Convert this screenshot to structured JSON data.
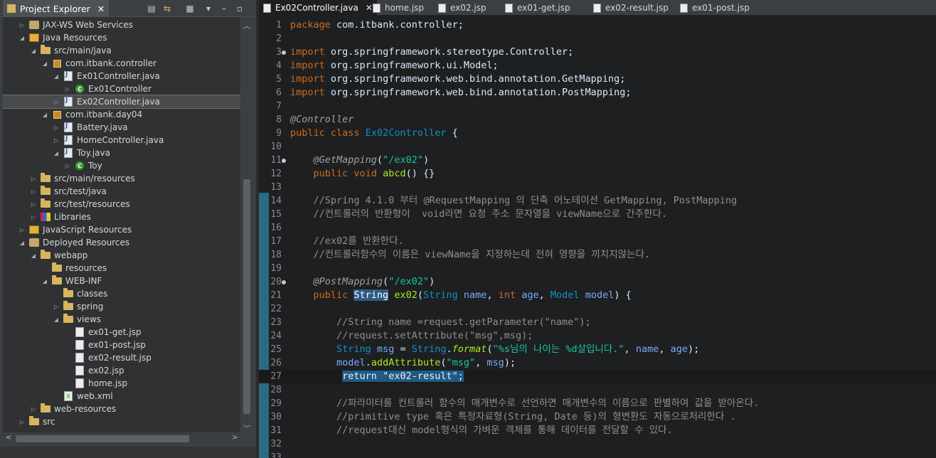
{
  "explorer": {
    "title": "Project Explorer",
    "tree": [
      {
        "label": "JAX-WS Web Services",
        "icon": "webservice-icon",
        "depth": 1,
        "twisty": "closed"
      },
      {
        "label": "Java Resources",
        "icon": "java-resources-icon",
        "depth": 1,
        "twisty": "open"
      },
      {
        "label": "src/main/java",
        "icon": "source-folder-icon",
        "depth": 2,
        "twisty": "open"
      },
      {
        "label": "com.itbank.controller",
        "icon": "package-icon",
        "depth": 3,
        "twisty": "open"
      },
      {
        "label": "Ex01Controller.java",
        "icon": "java-file-icon",
        "depth": 4,
        "twisty": "open"
      },
      {
        "label": "Ex01Controller",
        "icon": "class-icon",
        "depth": 5,
        "twisty": "closed"
      },
      {
        "label": "Ex02Controller.java",
        "icon": "java-file-icon",
        "depth": 4,
        "twisty": "closed",
        "selected": true
      },
      {
        "label": "com.itbank.day04",
        "icon": "package-icon",
        "depth": 3,
        "twisty": "open"
      },
      {
        "label": "Battery.java",
        "icon": "java-file-icon",
        "depth": 4,
        "twisty": "closed"
      },
      {
        "label": "HomeController.java",
        "icon": "java-file-icon",
        "depth": 4,
        "twisty": "closed"
      },
      {
        "label": "Toy.java",
        "icon": "java-file-icon",
        "depth": 4,
        "twisty": "open"
      },
      {
        "label": "Toy",
        "icon": "class-icon",
        "depth": 5,
        "twisty": "closed"
      },
      {
        "label": "src/main/resources",
        "icon": "source-folder-icon",
        "depth": 2,
        "twisty": "closed"
      },
      {
        "label": "src/test/java",
        "icon": "source-folder-icon",
        "depth": 2,
        "twisty": "closed"
      },
      {
        "label": "src/test/resources",
        "icon": "source-folder-icon",
        "depth": 2,
        "twisty": "closed"
      },
      {
        "label": "Libraries",
        "icon": "libraries-icon",
        "depth": 2,
        "twisty": "closed"
      },
      {
        "label": "JavaScript Resources",
        "icon": "javascript-resources-icon",
        "depth": 1,
        "twisty": "closed"
      },
      {
        "label": "Deployed Resources",
        "icon": "deployed-resources-icon",
        "depth": 1,
        "twisty": "open"
      },
      {
        "label": "webapp",
        "icon": "folder-icon",
        "depth": 2,
        "twisty": "open"
      },
      {
        "label": "resources",
        "icon": "folder-icon",
        "depth": 3,
        "twisty": "none"
      },
      {
        "label": "WEB-INF",
        "icon": "folder-icon",
        "depth": 3,
        "twisty": "open"
      },
      {
        "label": "classes",
        "icon": "folder-icon",
        "depth": 4,
        "twisty": "none"
      },
      {
        "label": "spring",
        "icon": "folder-icon",
        "depth": 4,
        "twisty": "closed"
      },
      {
        "label": "views",
        "icon": "folder-icon",
        "depth": 4,
        "twisty": "open"
      },
      {
        "label": "ex01-get.jsp",
        "icon": "jsp-file-icon",
        "depth": 5,
        "twisty": "none"
      },
      {
        "label": "ex01-post.jsp",
        "icon": "jsp-file-icon",
        "depth": 5,
        "twisty": "none"
      },
      {
        "label": "ex02-result.jsp",
        "icon": "jsp-file-icon",
        "depth": 5,
        "twisty": "none"
      },
      {
        "label": "ex02.jsp",
        "icon": "jsp-file-icon",
        "depth": 5,
        "twisty": "none"
      },
      {
        "label": "home.jsp",
        "icon": "jsp-file-icon",
        "depth": 5,
        "twisty": "none"
      },
      {
        "label": "web.xml",
        "icon": "xml-file-icon",
        "depth": 4,
        "twisty": "none"
      },
      {
        "label": "web-resources",
        "icon": "folder-icon",
        "depth": 2,
        "twisty": "closed"
      },
      {
        "label": "src",
        "icon": "folder-icon",
        "depth": 1,
        "twisty": "closed"
      }
    ]
  },
  "editor": {
    "tabs": [
      {
        "label": "Ex02Controller.java",
        "active": true
      },
      {
        "label": "home.jsp"
      },
      {
        "label": "ex02.jsp"
      },
      {
        "label": "ex01-get.jsp"
      },
      {
        "label": "ex02-result.jsp"
      },
      {
        "label": "ex01-post.jsp"
      }
    ],
    "current_line": 27,
    "lines": [
      {
        "n": "1",
        "segs": [
          [
            "kw",
            "package"
          ],
          [
            "",
            "com.itbank.controller;"
          ]
        ]
      },
      {
        "n": "2",
        "segs": []
      },
      {
        "n": "3",
        "bp": true,
        "segs": [
          [
            "kw",
            "import"
          ],
          [
            "",
            "org.springframework.stereotype.Controller;"
          ]
        ]
      },
      {
        "n": "4",
        "segs": [
          [
            "kw",
            "import"
          ],
          [
            "",
            "org.springframework.ui.Model;"
          ]
        ]
      },
      {
        "n": "5",
        "segs": [
          [
            "kw",
            "import"
          ],
          [
            "",
            "org.springframework.web.bind.annotation.GetMapping;"
          ]
        ]
      },
      {
        "n": "6",
        "segs": [
          [
            "kw",
            "import"
          ],
          [
            "",
            "org.springframework.web.bind.annotation.PostMapping;"
          ]
        ]
      },
      {
        "n": "7",
        "segs": []
      },
      {
        "n": "8",
        "segs": [
          [
            "ann",
            "@Controller"
          ]
        ]
      },
      {
        "n": "9",
        "segs": [
          [
            "kw",
            "public"
          ],
          [
            "kw",
            "class"
          ],
          [
            "typ",
            "Ex02Controller"
          ],
          [
            "",
            "{"
          ]
        ]
      },
      {
        "n": "10",
        "segs": []
      },
      {
        "n": "11",
        "bp": true,
        "segs": [
          [
            "ann",
            "    @GetMapping"
          ],
          [
            "",
            "("
          ],
          [
            "str",
            "\"/ex02\""
          ],
          [
            "",
            ")"
          ]
        ]
      },
      {
        "n": "12",
        "segs": [
          [
            "kw",
            "    public"
          ],
          [
            "kw",
            "void"
          ],
          [
            "mth",
            "abcd"
          ],
          [
            "",
            "() {}"
          ]
        ]
      },
      {
        "n": "13",
        "segs": []
      },
      {
        "n": "14",
        "segs": [
          [
            "cmt",
            "    //Spring 4.1.0 부터 @RequestMapping 의 단축 어노테이션 GetMapping, PostMapping"
          ]
        ]
      },
      {
        "n": "15",
        "segs": [
          [
            "cmt",
            "    //컨트롤러의 반환형이  void라면 요청 주소 문자열을 viewName으로 간주한다."
          ]
        ]
      },
      {
        "n": "16",
        "segs": []
      },
      {
        "n": "17",
        "segs": [
          [
            "cmt",
            "    //ex02를 반환한다."
          ]
        ]
      },
      {
        "n": "18",
        "segs": [
          [
            "cmt",
            "    //컨트롤러함수의 이름은 viewName을 지정하는데 전혀 영향을 끼치지않는다."
          ]
        ]
      },
      {
        "n": "19",
        "segs": []
      },
      {
        "n": "20",
        "bp": true,
        "segs": [
          [
            "ann",
            "    @PostMapping"
          ],
          [
            "",
            "("
          ],
          [
            "str",
            "\"/ex02\""
          ],
          [
            "",
            ")"
          ]
        ]
      },
      {
        "n": "21",
        "segs": [
          [
            "kw",
            "    public"
          ],
          [
            "sel",
            "String"
          ],
          [
            "mth",
            "ex02"
          ],
          [
            "",
            "("
          ],
          [
            "typ",
            "String"
          ],
          [
            "var",
            "name"
          ],
          [
            "",
            ","
          ],
          [
            "kw",
            "int"
          ],
          [
            "var",
            "age"
          ],
          [
            "",
            ","
          ],
          [
            "typ",
            "Model"
          ],
          [
            "var",
            "model"
          ],
          [
            "",
            ") {"
          ]
        ]
      },
      {
        "n": "22",
        "segs": []
      },
      {
        "n": "23",
        "segs": [
          [
            "cmt",
            "        //String name =request.getParameter(\"name\");"
          ]
        ]
      },
      {
        "n": "24",
        "segs": [
          [
            "cmt",
            "        //request.setAttribute(\"msg\",msg);"
          ]
        ]
      },
      {
        "n": "25",
        "segs": [
          [
            "typ",
            "        String"
          ],
          [
            "var",
            "msg"
          ],
          [
            "",
            "="
          ],
          [
            "typ",
            "String"
          ],
          [
            "",
            "."
          ],
          [
            "mth ital",
            "format"
          ],
          [
            "",
            "("
          ],
          [
            "str",
            "\"%s님의 나이는 %d살입니다.\""
          ],
          [
            "",
            ","
          ],
          [
            "var",
            "name"
          ],
          [
            "",
            ","
          ],
          [
            "var",
            "age"
          ],
          [
            "",
            ");"
          ]
        ]
      },
      {
        "n": "26",
        "segs": [
          [
            "var",
            "        model"
          ],
          [
            "",
            "."
          ],
          [
            "mth",
            "addAttribute"
          ],
          [
            "",
            "("
          ],
          [
            "str",
            "\"msg\""
          ],
          [
            "",
            ","
          ],
          [
            "var",
            "msg"
          ],
          [
            "",
            ");"
          ]
        ]
      },
      {
        "n": "27",
        "segs": [
          [
            "",
            "        "
          ],
          [
            "ssel",
            "return \"ex02-result\";"
          ]
        ]
      },
      {
        "n": "28",
        "segs": []
      },
      {
        "n": "29",
        "segs": [
          [
            "cmt",
            "        //파라미터를 컨트롤러 함수의 매개변수로 선언하면 매개변수의 이름으로 판별하여 값을 받아온다."
          ]
        ]
      },
      {
        "n": "30",
        "segs": [
          [
            "cmt",
            "        //primitive type 혹은 특정자료형(String, Date 등)의 형변환도 자동으로처리한다 ."
          ]
        ]
      },
      {
        "n": "31",
        "segs": [
          [
            "cmt",
            "        //request대신 model형식의 가벼운 객체를 통해 데이터를 전달할 수 있다."
          ]
        ]
      },
      {
        "n": "32",
        "segs": []
      },
      {
        "n": "33",
        "segs": []
      }
    ]
  }
}
